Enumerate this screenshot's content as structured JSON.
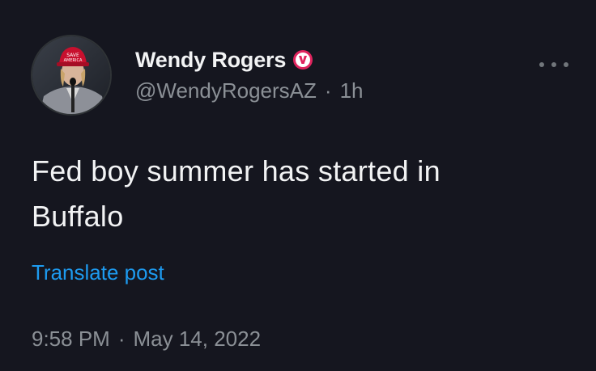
{
  "author": {
    "display_name": "Wendy Rogers",
    "verified_badge_icon": "verified-v-badge-icon",
    "badge_color": "#e0245e",
    "handle": "@WendyRogersAZ",
    "separator": "·",
    "relative_time": "1h",
    "avatar_icon": "profile-photo-avatar"
  },
  "tweet": {
    "text_line1": "Fed boy summer has started in",
    "text_line2": "Buffalo"
  },
  "actions": {
    "translate_label": "Translate post",
    "more_icon": "more-options-icon"
  },
  "meta": {
    "time": "9:58 PM",
    "separator": "·",
    "date": "May 14, 2022"
  },
  "colors": {
    "background": "#15161f",
    "link": "#1d9bf0",
    "secondary_text": "#8b9096"
  }
}
